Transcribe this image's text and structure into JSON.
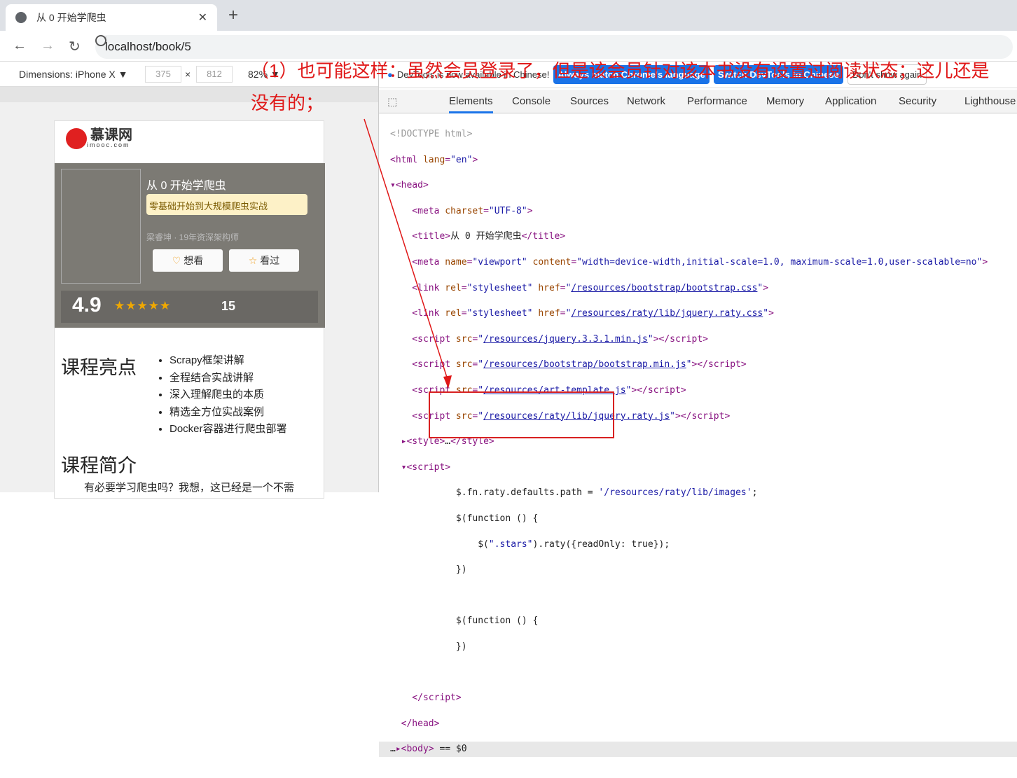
{
  "browser": {
    "tab_title": "从 0 开始学爬虫",
    "url": "localhost/book/5"
  },
  "device": {
    "label": "Dimensions: iPhone X ▼",
    "width": "375",
    "x": "×",
    "height": "812",
    "zoom": "82% ▼"
  },
  "page": {
    "logo_text": "慕课网",
    "logo_sub": "imooc.com",
    "book_title": "从 0 开始学爬虫",
    "tagline": "零基础开始到大规模爬虫实战",
    "author": "梁睿坤 · 19年资深架构师",
    "want_btn": "想看",
    "read_btn": "看过",
    "score": "4.9",
    "stars": "★★★★★",
    "rating_count": "15",
    "highlights_title": "课程亮点",
    "highlights": [
      "Scrapy框架讲解",
      "全程结合实战讲解",
      "深入理解爬虫的本质",
      "精选全方位实战案例",
      "Docker容器进行爬虫部署"
    ],
    "intro_title": "课程简介",
    "intro_text": "有必要学习爬虫吗？我想，这已经是一个不需"
  },
  "devtools": {
    "info_text": "DevTools is now available in Chinese!",
    "btn_match": "Always match Chrome's language",
    "btn_switch": "Switch DevTools to Chinese",
    "btn_dont": "Don't show again",
    "tabs": [
      "Elements",
      "Console",
      "Sources",
      "Network",
      "Performance",
      "Memory",
      "Application",
      "Security",
      "Lighthouse"
    ]
  },
  "annotation": "（1）也可能这样：虽然会员登录了，但是该会员针对该本书没有设置过阅读状态；这儿还是没有的；"
}
